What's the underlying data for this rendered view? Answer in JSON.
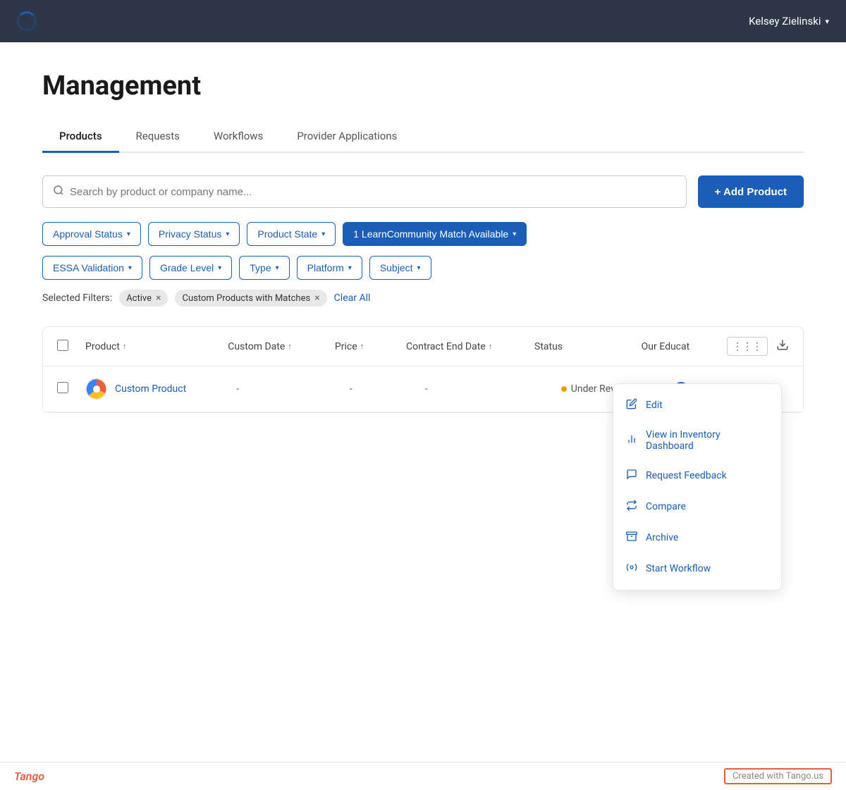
{
  "nav": {
    "user_name": "Kelsey Zielinski"
  },
  "page": {
    "title": "Management"
  },
  "tabs": [
    {
      "id": "products",
      "label": "Products",
      "active": true
    },
    {
      "id": "requests",
      "label": "Requests",
      "active": false
    },
    {
      "id": "workflows",
      "label": "Workflows",
      "active": false
    },
    {
      "id": "provider-applications",
      "label": "Provider Applications",
      "active": false
    }
  ],
  "search": {
    "placeholder": "Search by product or company name..."
  },
  "buttons": {
    "add_product": "+ Add Product"
  },
  "filters": [
    {
      "id": "approval-status",
      "label": "Approval Status",
      "highlighted": false
    },
    {
      "id": "privacy-status",
      "label": "Privacy Status",
      "highlighted": false
    },
    {
      "id": "product-state",
      "label": "Product State",
      "highlighted": false
    },
    {
      "id": "learn-community",
      "label": "1 LearnCommunity Match Available",
      "highlighted": true
    },
    {
      "id": "essa-validation",
      "label": "ESSA Validation",
      "highlighted": false
    },
    {
      "id": "grade-level",
      "label": "Grade Level",
      "highlighted": false
    },
    {
      "id": "type",
      "label": "Type",
      "highlighted": false
    },
    {
      "id": "platform",
      "label": "Platform",
      "highlighted": false
    },
    {
      "id": "subject",
      "label": "Subject",
      "highlighted": false
    }
  ],
  "selected_filters": {
    "label": "Selected Filters:",
    "tags": [
      {
        "id": "active-tag",
        "label": "Active"
      },
      {
        "id": "custom-products-tag",
        "label": "Custom Products with Matches"
      }
    ],
    "clear_all": "Clear All"
  },
  "table": {
    "columns": [
      {
        "id": "product",
        "label": "Product",
        "sortable": true
      },
      {
        "id": "custom-date",
        "label": "Custom Date",
        "sortable": true
      },
      {
        "id": "price",
        "label": "Price",
        "sortable": true
      },
      {
        "id": "contract-end-date",
        "label": "Contract End Date",
        "sortable": true
      },
      {
        "id": "status",
        "label": "Status",
        "sortable": false
      },
      {
        "id": "our-educat",
        "label": "Our Educat",
        "sortable": false
      }
    ],
    "rows": [
      {
        "id": "custom-product-row",
        "product_name": "Custom Product",
        "custom_date": "-",
        "price": "-",
        "contract_end_date": "-",
        "status": "Under Review",
        "our_educat": "-",
        "has_spinner": true
      }
    ]
  },
  "context_menu": {
    "items": [
      {
        "id": "edit",
        "label": "Edit",
        "icon": "✏️"
      },
      {
        "id": "view-inventory",
        "label": "View in Inventory Dashboard",
        "icon": "📊"
      },
      {
        "id": "request-feedback",
        "label": "Request Feedback",
        "icon": "💬"
      },
      {
        "id": "compare",
        "label": "Compare",
        "icon": "↔"
      },
      {
        "id": "archive",
        "label": "Archive",
        "icon": "📥"
      },
      {
        "id": "start-workflow",
        "label": "Start Workflow",
        "icon": "⚙"
      }
    ]
  },
  "footer": {
    "brand": "Tango",
    "credit": "Created with Tango.us"
  }
}
